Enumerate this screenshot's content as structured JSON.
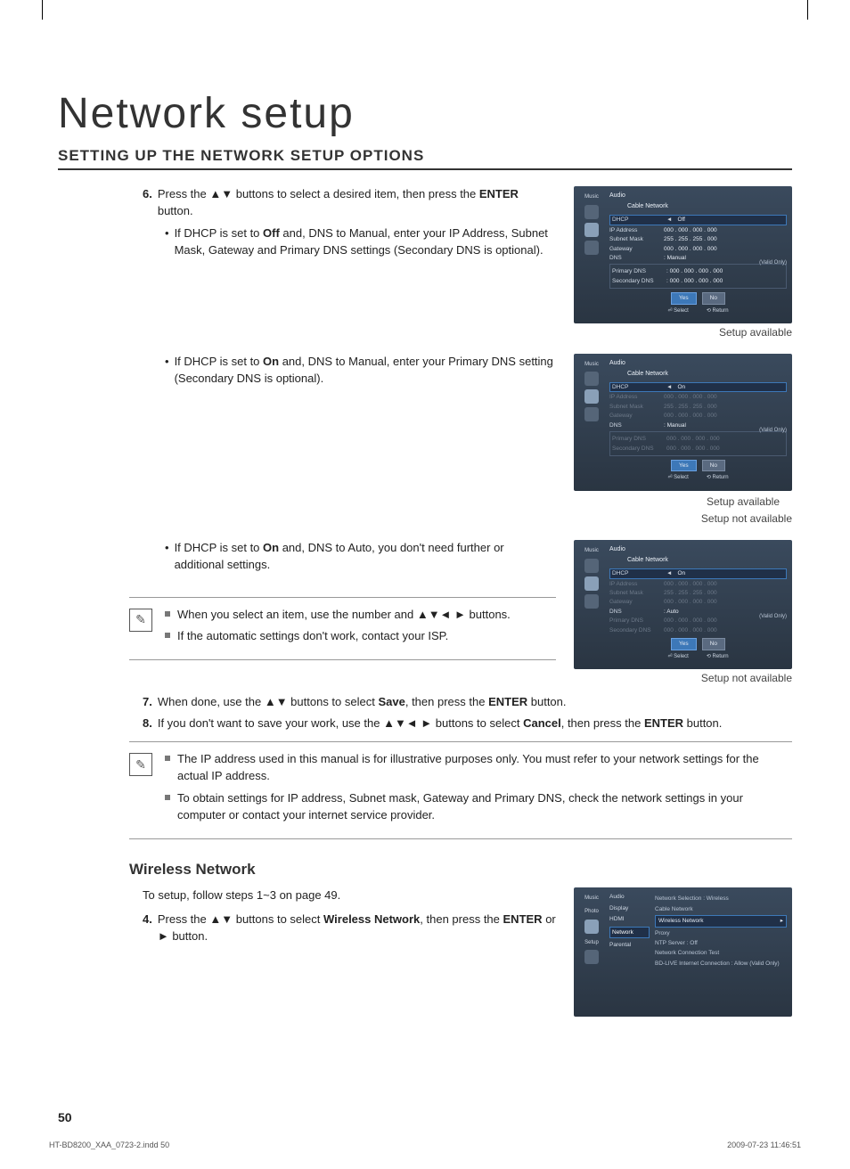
{
  "page": {
    "title": "Network setup",
    "subtitle": "SETTING UP THE NETWORK SETUP OPTIONS",
    "number": "50"
  },
  "step6": {
    "num": "6.",
    "text_a": "Press the ",
    "arrows": "▲▼",
    "text_b": " buttons to select a desired item, then press the ",
    "enter": "ENTER",
    "text_c": " button.",
    "b1a": "If DHCP is set to ",
    "b1off": "Off",
    "b1b": " and, DNS to Manual, enter your IP Address, Subnet Mask, Gateway and Primary DNS settings (Secondary DNS is optional).",
    "b2a": "If DHCP is set to ",
    "b2on": "On",
    "b2b": " and, DNS to Manual, enter your Primary DNS setting (Secondary DNS is optional).",
    "b3a": "If DHCP is set to ",
    "b3on": "On",
    "b3b": " and, DNS to Auto, you don't need further or additional settings."
  },
  "note1": {
    "i1a": "When you select an item, use the number and ",
    "i1arrows": "▲▼◄ ►",
    "i1b": " buttons.",
    "i2": "If the automatic settings don't work, contact your ISP."
  },
  "step7": {
    "num": "7.",
    "a": "When done, use the ",
    "arrows": "▲▼",
    "b": " buttons to select ",
    "save": "Save",
    "c": ", then press the ",
    "enter": "ENTER",
    "d": " button."
  },
  "step8": {
    "num": "8.",
    "a": "If you don't want to save your work, use the ",
    "arrows": "▲▼◄ ►",
    "b": " buttons to select ",
    "cancel": "Cancel",
    "c": ", then press the ",
    "enter": "ENTER",
    "d": " button."
  },
  "note2": {
    "i1": "The IP address used in this manual is for illustrative purposes only. You must refer to your network settings for the actual IP address.",
    "i2": "To obtain settings for IP address, Subnet mask, Gateway and Primary DNS, check the network settings in your computer or contact your internet service provider."
  },
  "wireless": {
    "heading": "Wireless Network",
    "intro": "To setup, follow steps 1~3 on page 49.",
    "s4num": "4.",
    "s4a": "Press the ",
    "s4arrows": "▲▼",
    "s4b": " buttons to select ",
    "s4wn": "Wireless Network",
    "s4c": ", then press the ",
    "s4enter": "ENTER",
    "s4d": " or ",
    "s4right": "►",
    "s4e": " button."
  },
  "captions": {
    "sa": "Setup available",
    "sna": "Setup not available"
  },
  "osd": {
    "music": "Music",
    "photo": "Photo",
    "setup": "Setup",
    "audio": "Audio",
    "cable": "Cable Network",
    "dhcp": "DHCP",
    "on": "On",
    "off": "Off",
    "ip": "IP Address",
    "sm": "Subnet Mask",
    "gw": "Gateway",
    "dns": "DNS",
    "manual": "Manual",
    "auto": "Auto",
    "pdns": "Primary DNS",
    "sdns": "Secondary DNS",
    "zeros": "000 . 000 . 000 . 000",
    "mask": "255 . 255 . 255 . 000",
    "yes": "Yes",
    "no": "No",
    "select": "Select",
    "return": "Return",
    "valid": "(Valid Only)",
    "display": "Display",
    "hdmi": "HDMI",
    "network": "Network",
    "parental": "Parental",
    "netsel": "Network Selection : Wireless",
    "wn": "Wireless Network",
    "proxy": "Proxy",
    "ntp": "NTP Server",
    "ntpoff": ": Off",
    "nct": "Network Connection Test",
    "bdlive": "BD-LIVE Internet Connection",
    "allow": ": Allow (Valid Only)"
  },
  "footer": {
    "left": "HT-BD8200_XAA_0723-2.indd   50",
    "right": "2009-07-23   11:46:51"
  }
}
